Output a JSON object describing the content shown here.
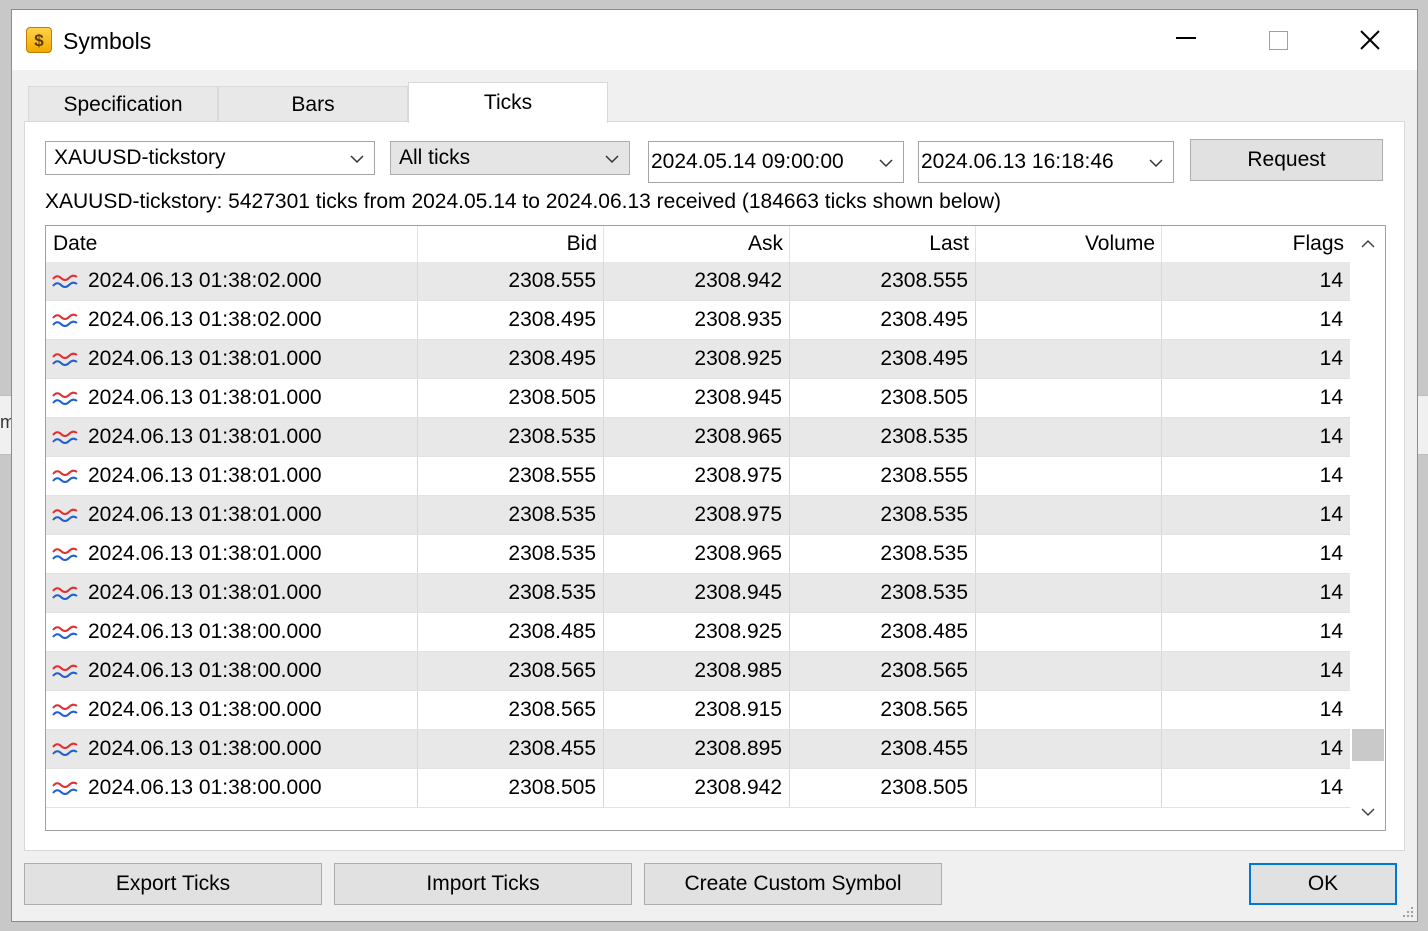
{
  "window": {
    "title": "Symbols",
    "app_icon": "dollar-coin-icon",
    "controls": [
      "minimize-icon",
      "maximize-icon",
      "close-icon"
    ]
  },
  "tabs": [
    {
      "label": "Specification",
      "active": false
    },
    {
      "label": "Bars",
      "active": false
    },
    {
      "label": "Ticks",
      "active": true
    }
  ],
  "filters": {
    "symbol": "XAUUSD-tickstory",
    "tick_type": "All ticks",
    "date_from": "2024.05.14 09:00:00",
    "date_to": "2024.06.13 16:18:46",
    "request_label": "Request"
  },
  "info_text": "XAUUSD-tickstory: 5427301 ticks from 2024.05.14 to 2024.06.13 received (184663 ticks shown below)",
  "table": {
    "columns": [
      "Date",
      "Bid",
      "Ask",
      "Last",
      "Volume",
      "Flags"
    ],
    "rows": [
      {
        "date": "2024.06.13 01:38:02.000",
        "bid": "2308.555",
        "ask": "2308.942",
        "last": "2308.555",
        "volume": "",
        "flags": "14"
      },
      {
        "date": "2024.06.13 01:38:02.000",
        "bid": "2308.495",
        "ask": "2308.935",
        "last": "2308.495",
        "volume": "",
        "flags": "14"
      },
      {
        "date": "2024.06.13 01:38:01.000",
        "bid": "2308.495",
        "ask": "2308.925",
        "last": "2308.495",
        "volume": "",
        "flags": "14"
      },
      {
        "date": "2024.06.13 01:38:01.000",
        "bid": "2308.505",
        "ask": "2308.945",
        "last": "2308.505",
        "volume": "",
        "flags": "14"
      },
      {
        "date": "2024.06.13 01:38:01.000",
        "bid": "2308.535",
        "ask": "2308.965",
        "last": "2308.535",
        "volume": "",
        "flags": "14"
      },
      {
        "date": "2024.06.13 01:38:01.000",
        "bid": "2308.555",
        "ask": "2308.975",
        "last": "2308.555",
        "volume": "",
        "flags": "14"
      },
      {
        "date": "2024.06.13 01:38:01.000",
        "bid": "2308.535",
        "ask": "2308.975",
        "last": "2308.535",
        "volume": "",
        "flags": "14"
      },
      {
        "date": "2024.06.13 01:38:01.000",
        "bid": "2308.535",
        "ask": "2308.965",
        "last": "2308.535",
        "volume": "",
        "flags": "14"
      },
      {
        "date": "2024.06.13 01:38:01.000",
        "bid": "2308.535",
        "ask": "2308.945",
        "last": "2308.535",
        "volume": "",
        "flags": "14"
      },
      {
        "date": "2024.06.13 01:38:00.000",
        "bid": "2308.485",
        "ask": "2308.925",
        "last": "2308.485",
        "volume": "",
        "flags": "14"
      },
      {
        "date": "2024.06.13 01:38:00.000",
        "bid": "2308.565",
        "ask": "2308.985",
        "last": "2308.565",
        "volume": "",
        "flags": "14"
      },
      {
        "date": "2024.06.13 01:38:00.000",
        "bid": "2308.565",
        "ask": "2308.915",
        "last": "2308.565",
        "volume": "",
        "flags": "14"
      },
      {
        "date": "2024.06.13 01:38:00.000",
        "bid": "2308.455",
        "ask": "2308.895",
        "last": "2308.455",
        "volume": "",
        "flags": "14"
      },
      {
        "date": "2024.06.13 01:38:00.000",
        "bid": "2308.505",
        "ask": "2308.942",
        "last": "2308.505",
        "volume": "",
        "flags": "14"
      }
    ],
    "row_icon": "tick-wave-icon",
    "scroll_position": 0.93
  },
  "buttons": {
    "export": "Export Ticks",
    "import": "Import Ticks",
    "custom": "Create Custom Symbol",
    "ok": "OK"
  },
  "colors": {
    "bid_line": "#e03030",
    "ask_line": "#2060d0",
    "default_button_border": "#0078d7"
  },
  "background_fragment": "m"
}
